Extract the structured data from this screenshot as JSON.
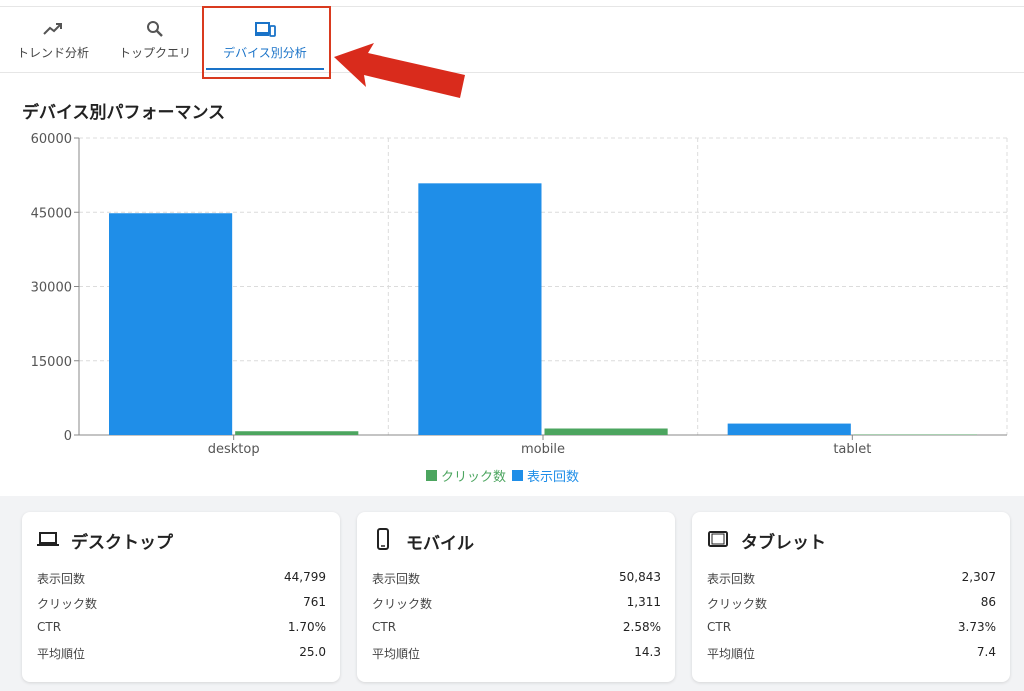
{
  "tabs": [
    {
      "label": "トレンド分析",
      "icon": "trending-up-icon"
    },
    {
      "label": "トップクエリ",
      "icon": "search-icon"
    },
    {
      "label": "デバイス別分析",
      "icon": "devices-icon",
      "active": true
    }
  ],
  "section_title": "デバイス別パフォーマンス",
  "chart_data": {
    "type": "bar",
    "categories": [
      "desktop",
      "mobile",
      "tablet"
    ],
    "series": [
      {
        "name": "表示回数",
        "values": [
          44799,
          50843,
          2307
        ],
        "color": "#1f8ee8"
      },
      {
        "name": "クリック数",
        "values": [
          761,
          1311,
          86
        ],
        "color": "#4ca55f"
      }
    ],
    "yticks": [
      "0",
      "15000",
      "30000",
      "45000",
      "60000"
    ],
    "ylim": [
      0,
      60000
    ],
    "grid": true,
    "legend": "bottom"
  },
  "legend": [
    {
      "label": "クリック数",
      "color": "#4ca55f"
    },
    {
      "label": "表示回数",
      "color": "#1f8ee8"
    }
  ],
  "cards": [
    {
      "title": "デスクトップ",
      "icon": "laptop-icon",
      "rows": [
        {
          "k": "表示回数",
          "v": "44,799"
        },
        {
          "k": "クリック数",
          "v": "761"
        },
        {
          "k": "CTR",
          "v": "1.70%"
        },
        {
          "k": "平均順位",
          "v": "25.0"
        }
      ]
    },
    {
      "title": "モバイル",
      "icon": "smartphone-icon",
      "rows": [
        {
          "k": "表示回数",
          "v": "50,843"
        },
        {
          "k": "クリック数",
          "v": "1,311"
        },
        {
          "k": "CTR",
          "v": "2.58%"
        },
        {
          "k": "平均順位",
          "v": "14.3"
        }
      ]
    },
    {
      "title": "タブレット",
      "icon": "tablet-icon",
      "rows": [
        {
          "k": "表示回数",
          "v": "2,307"
        },
        {
          "k": "クリック数",
          "v": "86"
        },
        {
          "k": "CTR",
          "v": "3.73%"
        },
        {
          "k": "平均順位",
          "v": "7.4"
        }
      ]
    }
  ]
}
